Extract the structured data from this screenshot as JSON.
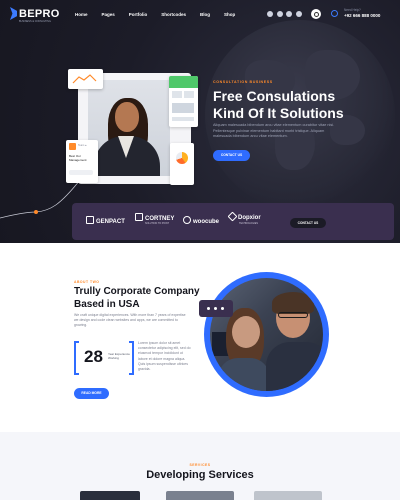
{
  "brand": {
    "name": "BEPRO",
    "tagline": "BUSINESS & CONSULTING"
  },
  "nav": {
    "items": [
      "Home",
      "Pages",
      "Portfolio",
      "Shortcodes",
      "Blog",
      "Shop"
    ]
  },
  "header": {
    "need_help": "Need Help?",
    "phone": "+92 666 888 0000",
    "socials": [
      "facebook-icon",
      "twitter-icon",
      "instagram-icon",
      "youtube-icon"
    ]
  },
  "hero": {
    "tagline": "CONSULTATION BUSINESS",
    "title": "Free Consulations Kind Of It Solutions",
    "text": "Aliquam malesuada bibendum arcu vitae elementum curabitur vitae nisi. Pellentesque pulvinar elementum habitant morbi tristique. Aliquam malesuada bibendum arcu vitae elementum.",
    "button": "CONTACT US",
    "card_team_title": "Best Our Management",
    "card_team_label": "Team ●"
  },
  "partners": [
    {
      "name": "GENPACT",
      "sub": ""
    },
    {
      "name": "CORTNEY",
      "sub": "SOLUTION TO POINT"
    },
    {
      "name": "woocube",
      "sub": ""
    },
    {
      "name": "Dopxior",
      "sub": "TECHNOLOGIES"
    }
  ],
  "partners_button": "CONTACT US",
  "about": {
    "tag": "ABOUT TWO",
    "title": "Trully Corporate Company Based in USA",
    "text": "We craft unique digital experiences. With more than 7 years of expertise we design and code clean websites and apps, we are committed to growing.",
    "years": "28",
    "years_label": "Year Experience Working",
    "text2": "Lorem ipsum dolor sit amet consectetur adipiscing elit, sed do eiusmod tempor incididunt ut labore et dolore magna aliqua. Quis ipsum suspendisse ultrices gravida.",
    "button": "READ MORE"
  },
  "services": {
    "tag": "SERVICES",
    "title": "Developing Services"
  }
}
